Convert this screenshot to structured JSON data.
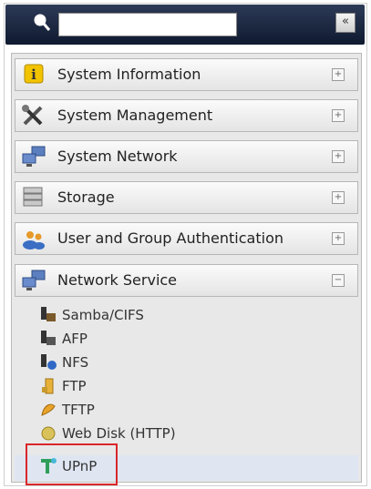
{
  "search": {
    "value": "",
    "placeholder": "",
    "collapse_glyph": "«"
  },
  "sections": [
    {
      "label": "System Information",
      "icon": "info-icon",
      "state": "+"
    },
    {
      "label": "System Management",
      "icon": "tools-icon",
      "state": "+"
    },
    {
      "label": "System Network",
      "icon": "network-icon",
      "state": "+"
    },
    {
      "label": "Storage",
      "icon": "storage-icon",
      "state": "+"
    },
    {
      "label": "User and Group Authentication",
      "icon": "users-icon",
      "state": "+"
    },
    {
      "label": "Network Service",
      "icon": "network-service-icon",
      "state": "−"
    }
  ],
  "network_service_items": [
    {
      "label": "Samba/CIFS",
      "icon": "samba-icon"
    },
    {
      "label": "AFP",
      "icon": "afp-icon"
    },
    {
      "label": "NFS",
      "icon": "nfs-icon"
    },
    {
      "label": "FTP",
      "icon": "ftp-icon"
    },
    {
      "label": "TFTP",
      "icon": "tftp-icon"
    },
    {
      "label": "Web Disk (HTTP)",
      "icon": "web-disk-icon"
    },
    {
      "label": "UPnP",
      "icon": "upnp-icon"
    }
  ],
  "selected_item": "UPnP",
  "colors": {
    "highlight_border": "#d9262b",
    "selected_row": "#dfe6f2",
    "topbar": "#0f1a30"
  }
}
